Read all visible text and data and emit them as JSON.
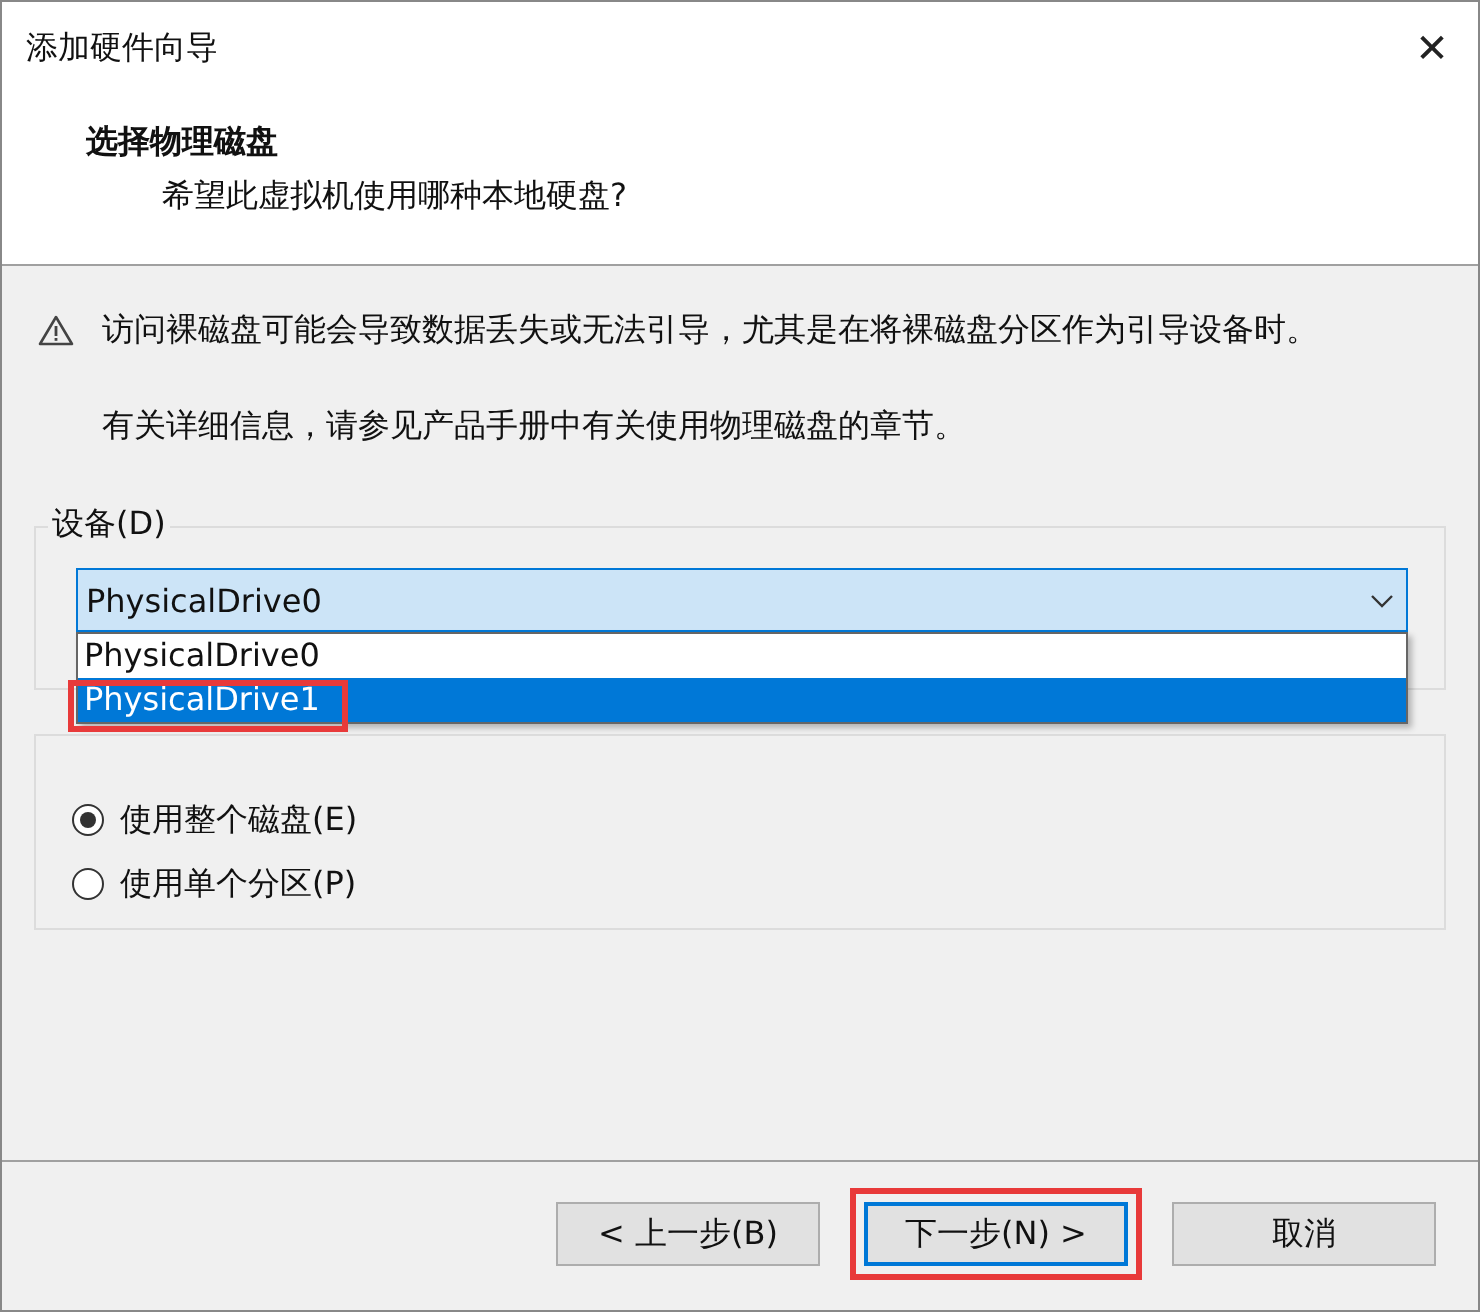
{
  "window": {
    "title": "添加硬件向导",
    "close": "✕"
  },
  "header": {
    "title": "选择物理磁盘",
    "subtitle": "希望此虚拟机使用哪种本地硬盘?"
  },
  "warning": {
    "text": "访问裸磁盘可能会导致数据丢失或无法引导，尤其是在将裸磁盘分区作为引导设备时。",
    "info": "有关详细信息，请参见产品手册中有关使用物理磁盘的章节。"
  },
  "device_group": {
    "label": "设备(D)",
    "combo": {
      "value": "PhysicalDrive0",
      "expanded": true
    },
    "options": [
      {
        "label": "PhysicalDrive0",
        "selected": false,
        "annotated": false
      },
      {
        "label": "PhysicalDrive1",
        "selected": true,
        "annotated": true
      }
    ]
  },
  "usage_group": {
    "radios": [
      {
        "label": "使用整个磁盘(E)",
        "selected": true
      },
      {
        "label": "使用单个分区(P)",
        "selected": false
      }
    ]
  },
  "buttons": [
    {
      "label": "< 上一步(B)",
      "default": false,
      "annotated": false
    },
    {
      "label": "下一步(N) >",
      "default": true,
      "annotated": true
    },
    {
      "label": "取消",
      "default": false,
      "annotated": false
    }
  ]
}
